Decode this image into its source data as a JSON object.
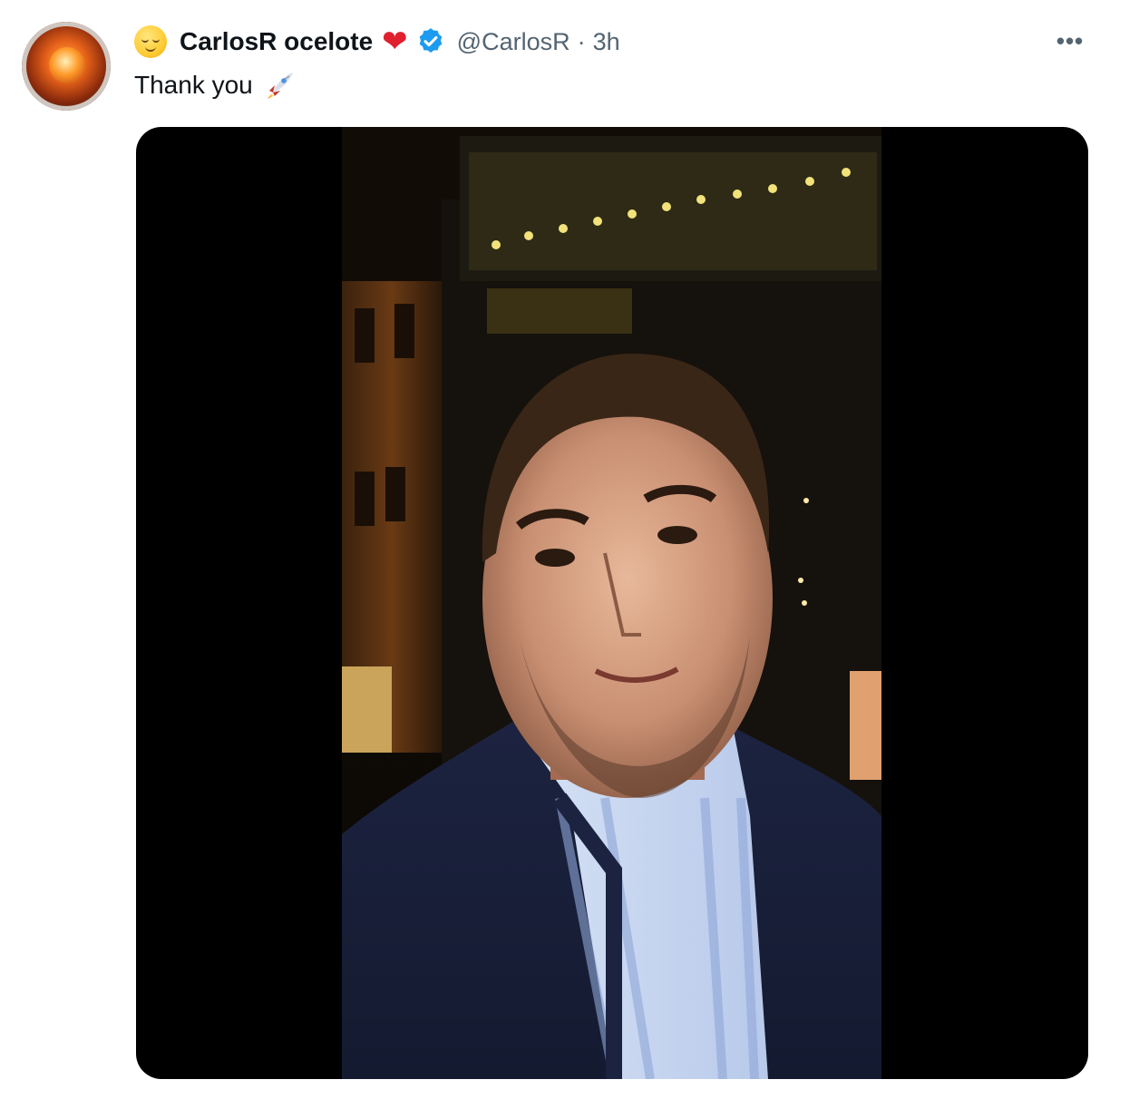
{
  "author": {
    "name_emoji": "relieved-face-emoji",
    "display_name": "CarlosR ocelote",
    "name_suffix_emoji": "red-heart-emoji",
    "verified": true,
    "handle": "@CarlosR",
    "separator": "·",
    "timestamp": "3h"
  },
  "tweet": {
    "text": "Thank you",
    "trailing_emoji": "rocket-emoji"
  },
  "more_button": {
    "label": "•••"
  },
  "colors": {
    "text_primary": "#0f1419",
    "text_secondary": "#536471",
    "verified_blue": "#1d9bf0",
    "heart_red": "#e0202e",
    "media_background": "#000000"
  },
  "media": {
    "type": "video",
    "description_icon": "video-thumbnail"
  }
}
